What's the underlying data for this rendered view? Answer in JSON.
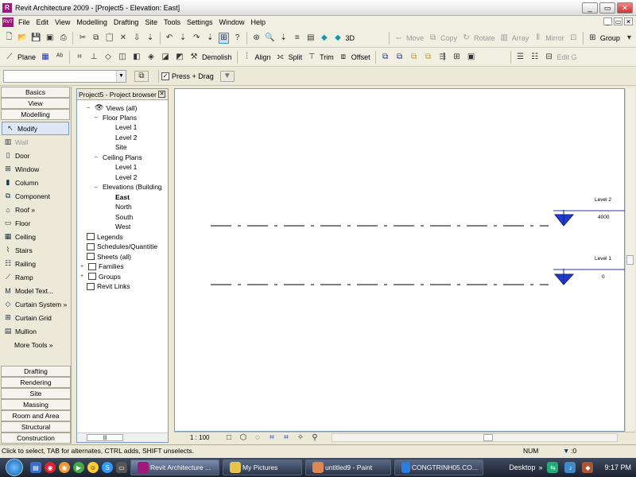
{
  "window": {
    "title": "Revit Architecture 2009 - [Project5 - Elevation: East]",
    "logo": "R",
    "controls": [
      "_",
      "▭",
      "✕"
    ]
  },
  "menu": {
    "items": [
      "File",
      "Edit",
      "View",
      "Modelling",
      "Drafting",
      "Site",
      "Tools",
      "Settings",
      "Window",
      "Help"
    ],
    "mdi": [
      "_",
      "▭",
      "✕"
    ]
  },
  "toolbar2": {
    "move": "Move",
    "copy": "Copy",
    "rotate": "Rotate",
    "array": "Array",
    "mirror": "Mirror",
    "group": "Group",
    "threed": "3D"
  },
  "toolbar3": {
    "plane": "Plane",
    "demolish": "Demolish",
    "align": "Align",
    "split": "Split",
    "trim": "Trim",
    "offset": "Offset",
    "editgroup": "Edit G"
  },
  "options": {
    "press_drag": "Press + Drag",
    "press_drag_checked": true
  },
  "designbar": {
    "tabs_top": [
      "Basics",
      "View",
      "Modelling"
    ],
    "items": [
      {
        "label": "Modify",
        "icon": "arrow-icon",
        "selected": true,
        "disabled": false
      },
      {
        "label": "Wall",
        "icon": "wall-icon",
        "selected": false,
        "disabled": true
      },
      {
        "label": "Door",
        "icon": "door-icon",
        "selected": false,
        "disabled": false
      },
      {
        "label": "Window",
        "icon": "window-icon",
        "selected": false,
        "disabled": false
      },
      {
        "label": "Column",
        "icon": "column-icon",
        "selected": false,
        "disabled": false
      },
      {
        "label": "Component",
        "icon": "component-icon",
        "selected": false,
        "disabled": false
      },
      {
        "label": "Roof »",
        "icon": "roof-icon",
        "selected": false,
        "disabled": false
      },
      {
        "label": "Floor",
        "icon": "floor-icon",
        "selected": false,
        "disabled": false
      },
      {
        "label": "Ceiling",
        "icon": "ceiling-icon",
        "selected": false,
        "disabled": false
      },
      {
        "label": "Stairs",
        "icon": "stairs-icon",
        "selected": false,
        "disabled": false
      },
      {
        "label": "Railing",
        "icon": "railing-icon",
        "selected": false,
        "disabled": false
      },
      {
        "label": "Ramp",
        "icon": "ramp-icon",
        "selected": false,
        "disabled": false
      },
      {
        "label": "Model Text...",
        "icon": "text-icon",
        "selected": false,
        "disabled": false
      },
      {
        "label": "Curtain System »",
        "icon": "curtain-system-icon",
        "selected": false,
        "disabled": false
      },
      {
        "label": "Curtain Grid",
        "icon": "curtain-grid-icon",
        "selected": false,
        "disabled": false
      },
      {
        "label": "Mullion",
        "icon": "mullion-icon",
        "selected": false,
        "disabled": false
      },
      {
        "label": "More Tools »",
        "icon": "",
        "selected": false,
        "disabled": false
      }
    ],
    "tabs_bottom": [
      "Drafting",
      "Rendering",
      "Site",
      "Massing",
      "Room and Area",
      "Structural",
      "Construction"
    ]
  },
  "browser": {
    "title": "Project5 - Project browser",
    "nodes": [
      {
        "label": "Views (all)",
        "bold": false
      },
      {
        "label": "Floor Plans",
        "bold": false
      },
      {
        "label": "Level 1",
        "bold": false
      },
      {
        "label": "Level 2",
        "bold": false
      },
      {
        "label": "Site",
        "bold": false
      },
      {
        "label": "Ceiling Plans",
        "bold": false
      },
      {
        "label": "Level 1",
        "bold": false
      },
      {
        "label": "Level 2",
        "bold": false
      },
      {
        "label": "Elevations (Building",
        "bold": false
      },
      {
        "label": "East",
        "bold": true
      },
      {
        "label": "North",
        "bold": false
      },
      {
        "label": "South",
        "bold": false
      },
      {
        "label": "West",
        "bold": false
      },
      {
        "label": "Legends",
        "bold": false
      },
      {
        "label": "Schedules/Quantitie",
        "bold": false
      },
      {
        "label": "Sheets (all)",
        "bold": false
      },
      {
        "label": "Families",
        "bold": false
      },
      {
        "label": "Groups",
        "bold": false
      },
      {
        "label": "Revit Links",
        "bold": false
      }
    ],
    "scroll_glyph": "|||"
  },
  "drawing": {
    "levels": [
      {
        "name": "Level 2",
        "elevation": "4000"
      },
      {
        "name": "Level 1",
        "elevation": "0"
      }
    ]
  },
  "viewcontrol": {
    "scale": "1 : 100"
  },
  "status": {
    "message": "Click to select, TAB for alternates, CTRL adds, SHIFT unselects.",
    "num": "NUM",
    "filter": ":0"
  },
  "taskbar": {
    "buttons": [
      "Revit Architecture ...",
      "My Pictures",
      "untitled9 - Paint",
      "CONGTRINH05.CO..."
    ],
    "active": 0,
    "desktop": "Desktop",
    "time": "9:17 PM"
  }
}
